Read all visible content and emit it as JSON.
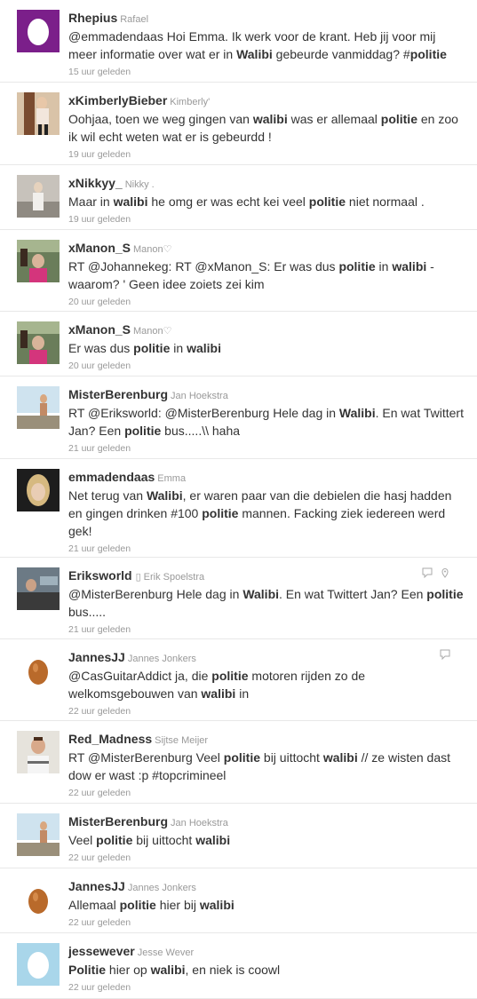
{
  "tweets": [
    {
      "screen_name": "Rhepius",
      "full_name": "Rafael",
      "segments": [
        [
          "@emmadendaas Hoi Emma. Ik werk voor de krant. Heb jij voor mij meer informatie over wat er in ",
          0
        ],
        [
          "Walibi",
          1
        ],
        [
          " gebeurde vanmiddag? #",
          0
        ],
        [
          "politie",
          1
        ]
      ],
      "time": "15 uur geleden",
      "avatar": "egg-purple"
    },
    {
      "screen_name": "xKimberlyBieber",
      "full_name": "Kimberly'",
      "segments": [
        [
          "Oohjaa, toen we weg gingen van ",
          0
        ],
        [
          "walibi",
          1
        ],
        [
          " was er allemaal ",
          0
        ],
        [
          "politie",
          1
        ],
        [
          " en zoo ik wil echt weten wat er is gebeurdd !",
          0
        ]
      ],
      "time": "19 uur geleden",
      "avatar": "photo-girl-standing"
    },
    {
      "screen_name": "xNikkyy_",
      "full_name": "Nikky .",
      "segments": [
        [
          "Maar in ",
          0
        ],
        [
          "walibi",
          1
        ],
        [
          " he omg er was echt kei veel ",
          0
        ],
        [
          "politie",
          1
        ],
        [
          " niet normaal .",
          0
        ]
      ],
      "time": "19 uur geleden",
      "avatar": "photo-room"
    },
    {
      "screen_name": "xManon_S",
      "full_name": "Manon♡",
      "segments": [
        [
          "RT @Johannekeg: RT @xManon_S: Er was dus ",
          0
        ],
        [
          "politie",
          1
        ],
        [
          " in ",
          0
        ],
        [
          "walibi",
          1
        ],
        [
          " - waarom? ' Geen idee zoiets zei kim",
          0
        ]
      ],
      "time": "20 uur geleden",
      "avatar": "photo-girl-pink"
    },
    {
      "screen_name": "xManon_S",
      "full_name": "Manon♡",
      "segments": [
        [
          "Er was dus ",
          0
        ],
        [
          "politie",
          1
        ],
        [
          " in ",
          0
        ],
        [
          "walibi",
          1
        ]
      ],
      "time": "20 uur geleden",
      "avatar": "photo-girl-pink"
    },
    {
      "screen_name": "MisterBerenburg",
      "full_name": "Jan Hoekstra",
      "segments": [
        [
          "RT @Eriksworld: @MisterBerenburg Hele dag in ",
          0
        ],
        [
          "Walibi",
          1
        ],
        [
          ". En wat Twittert Jan? Een ",
          0
        ],
        [
          "politie",
          1
        ],
        [
          " bus.....\\\\ haha",
          0
        ]
      ],
      "time": "21 uur geleden",
      "avatar": "photo-balcony"
    },
    {
      "screen_name": "emmadendaas",
      "full_name": "Emma",
      "segments": [
        [
          "Net terug van ",
          0
        ],
        [
          "Walibi",
          1
        ],
        [
          ", er waren paar van die debielen die hasj hadden en gingen drinken #100 ",
          0
        ],
        [
          "politie",
          1
        ],
        [
          " mannen. Facking ziek iedereen werd gek!",
          0
        ]
      ],
      "time": "21 uur geleden",
      "avatar": "photo-blonde"
    },
    {
      "screen_name": "Eriksworld",
      "full_name": "Erik Spoelstra",
      "segments": [
        [
          "@MisterBerenburg Hele dag in ",
          0
        ],
        [
          "Walibi",
          1
        ],
        [
          ". En wat Twittert Jan? Een ",
          0
        ],
        [
          "politie",
          1
        ],
        [
          " bus.....",
          0
        ]
      ],
      "time": "21 uur geleden",
      "avatar": "photo-car",
      "has_actions": true,
      "has_location": true,
      "verified_glyph": "▯"
    },
    {
      "screen_name": "JannesJJ",
      "full_name": "Jannes Jonkers",
      "segments": [
        [
          "@CasGuitarAddict ja, die ",
          0
        ],
        [
          "politie",
          1
        ],
        [
          " motoren rijden zo de welkomsgebouwen van ",
          0
        ],
        [
          "walibi",
          1
        ],
        [
          " in",
          0
        ]
      ],
      "time": "22 uur geleden",
      "avatar": "egg-brown",
      "has_actions": true
    },
    {
      "screen_name": "Red_Madness",
      "full_name": "Sijtse Meijer",
      "segments": [
        [
          "RT @MisterBerenburg Veel ",
          0
        ],
        [
          "politie",
          1
        ],
        [
          " bij uittocht ",
          0
        ],
        [
          "walibi",
          1
        ],
        [
          " // ze wisten dast dow er wast :p #topcrimineel",
          0
        ]
      ],
      "time": "22 uur geleden",
      "avatar": "photo-man"
    },
    {
      "screen_name": "MisterBerenburg",
      "full_name": "Jan Hoekstra",
      "segments": [
        [
          "Veel ",
          0
        ],
        [
          "politie",
          1
        ],
        [
          " bij uittocht ",
          0
        ],
        [
          "walibi",
          1
        ]
      ],
      "time": "22 uur geleden",
      "avatar": "photo-balcony"
    },
    {
      "screen_name": "JannesJJ",
      "full_name": "Jannes Jonkers",
      "segments": [
        [
          "Allemaal ",
          0
        ],
        [
          "politie",
          1
        ],
        [
          " hier bij ",
          0
        ],
        [
          "walibi",
          1
        ]
      ],
      "time": "22 uur geleden",
      "avatar": "egg-brown"
    },
    {
      "screen_name": "jessewever",
      "full_name": "Jesse Wever",
      "segments": [
        [
          "Politie",
          1
        ],
        [
          " hier op ",
          0
        ],
        [
          "walibi",
          1
        ],
        [
          ", en niek is coowl",
          0
        ]
      ],
      "time": "22 uur geleden",
      "avatar": "egg-blue"
    }
  ]
}
